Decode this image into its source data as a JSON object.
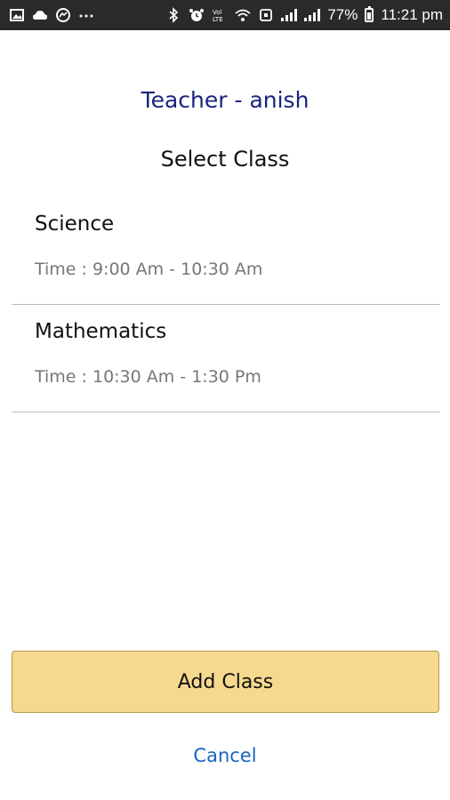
{
  "status_bar": {
    "battery_percent": "77%",
    "time": "11:21 pm",
    "volte_label": "Vol LTE",
    "notification_icons": [
      "gallery-icon",
      "cloud-icon",
      "messenger-icon",
      "more-icon"
    ],
    "system_icons": [
      "bluetooth-icon",
      "alarm-icon",
      "volte-icon",
      "wifi-icon",
      "signal-icon",
      "battery-icon"
    ]
  },
  "header": {
    "teacher": "Teacher - anish",
    "subtitle": "Select Class"
  },
  "classes": [
    {
      "name": "Science",
      "time": "Time : 9:00 Am - 10:30 Am"
    },
    {
      "name": "Mathematics",
      "time": "Time : 10:30 Am - 1:30 Pm"
    }
  ],
  "actions": {
    "add_class": "Add Class",
    "cancel": "Cancel"
  },
  "colors": {
    "status_bar": "#2a2a2a",
    "teacher_title": "#1a237e",
    "button_fill": "#f6d88e",
    "button_border": "#b89a4a",
    "cancel_link": "#1565c0",
    "divider": "#bdbdbd"
  }
}
